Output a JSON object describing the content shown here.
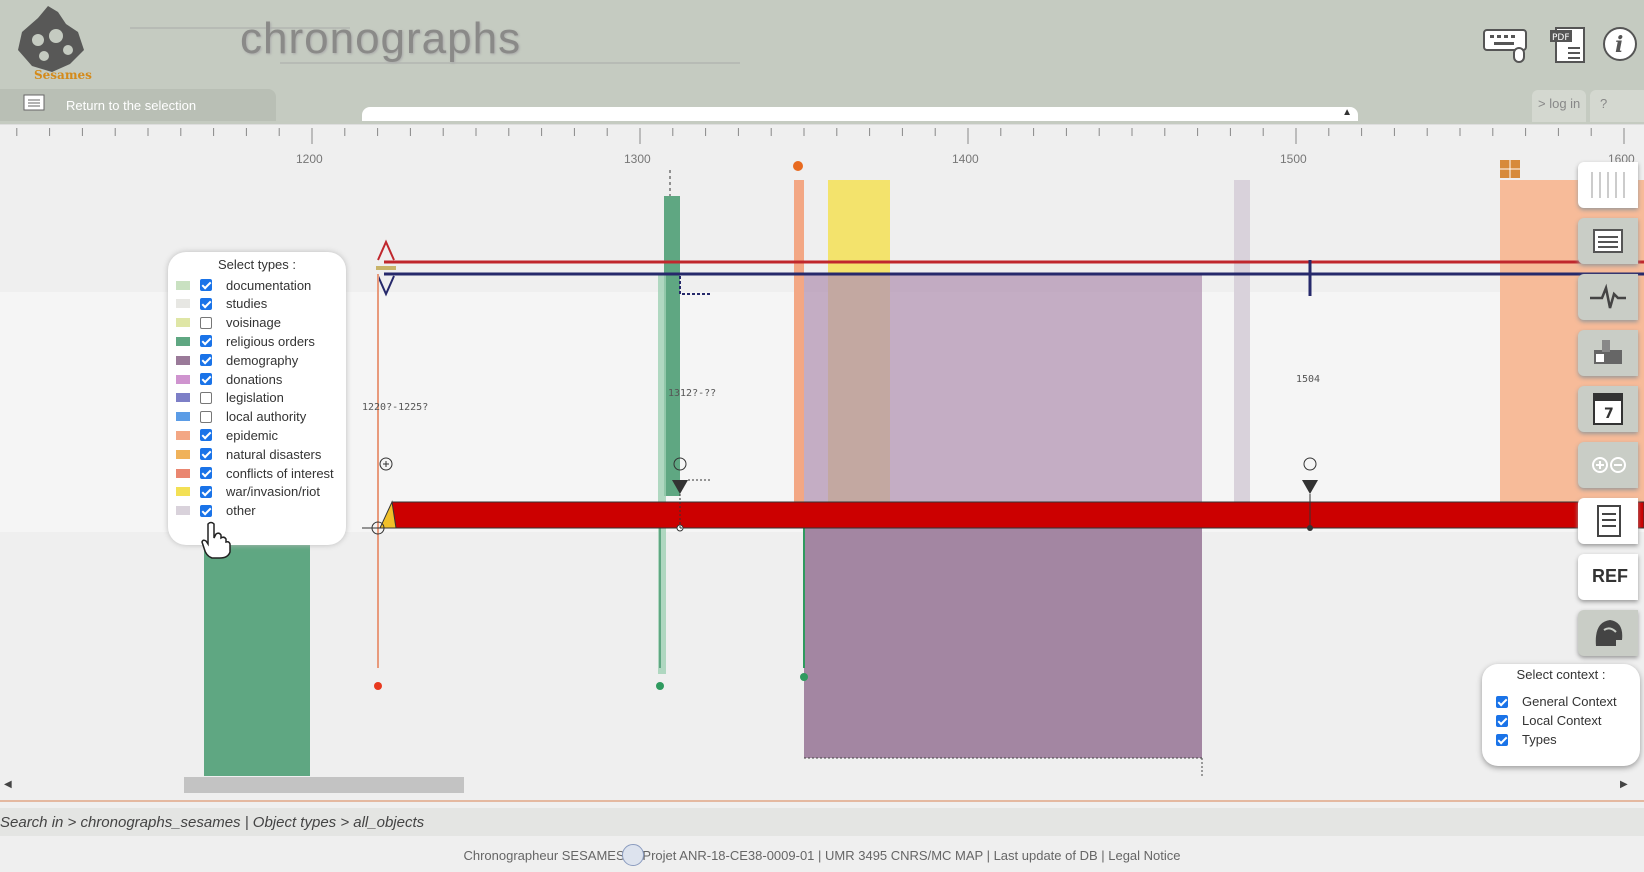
{
  "header": {
    "app_title": "chronographs",
    "logo_text": "Sesames",
    "back_label": "Return to the selection",
    "login_label": "> log in",
    "help_label": "?",
    "icons": [
      "keyboard-mouse-icon",
      "pdf-icon",
      "info-icon"
    ]
  },
  "timeline": {
    "axis_years": [
      "1200",
      "1300",
      "1400",
      "1500",
      "1600"
    ],
    "labels": {
      "event_a": "1220?-1225?",
      "event_b": "1312?-??",
      "event_c": "1504"
    }
  },
  "types_panel": {
    "title": "Select types :",
    "items": [
      {
        "label": "documentation",
        "color": "#c9e1c1",
        "checked": true
      },
      {
        "label": "studies",
        "color": "#e7e7e3",
        "checked": true
      },
      {
        "label": "voisinage",
        "color": "#dfe6a6",
        "checked": false
      },
      {
        "label": "religious orders",
        "color": "#5fa782",
        "checked": true
      },
      {
        "label": "demography",
        "color": "#9a7a99",
        "checked": true
      },
      {
        "label": "donations",
        "color": "#cf94cf",
        "checked": true
      },
      {
        "label": "legislation",
        "color": "#7d7fc7",
        "checked": false
      },
      {
        "label": "local authority",
        "color": "#5b9ce6",
        "checked": false
      },
      {
        "label": "epidemic",
        "color": "#f3a784",
        "checked": true
      },
      {
        "label": "natural disasters",
        "color": "#f0b25a",
        "checked": true
      },
      {
        "label": "conflicts of interest",
        "color": "#ea8670",
        "checked": true
      },
      {
        "label": "war/invasion/riot",
        "color": "#f3e055",
        "checked": true
      },
      {
        "label": "other",
        "color": "#d9d2db",
        "checked": true
      }
    ]
  },
  "toolbar": {
    "ref_label": "REF",
    "calendar_day": "7",
    "icons": [
      "timeline-scale-icon",
      "list-icon",
      "heartbeat-icon",
      "monument-icon",
      "calendar-icon",
      "zoom-icon",
      "document-icon",
      "ref-icon",
      "helmet-icon"
    ]
  },
  "context_panel": {
    "title": "Select context :",
    "items": [
      {
        "label": "General Context",
        "checked": true
      },
      {
        "label": "Local Context",
        "checked": true
      },
      {
        "label": "Types",
        "checked": true
      }
    ]
  },
  "breadcrumb": "Search in > chronographs_sesames | Object types > all_objects",
  "footer": "Chronographeur SESAMES |    Projet ANR-18-CE38-0009-01 | UMR 3495 CNRS/MC MAP | Last update of DB | Legal Notice",
  "colors": {
    "header_bg": "#c5cbc1",
    "red_bar": "#cc0000",
    "demography": "#9a7a99",
    "religious": "#5fa782"
  }
}
